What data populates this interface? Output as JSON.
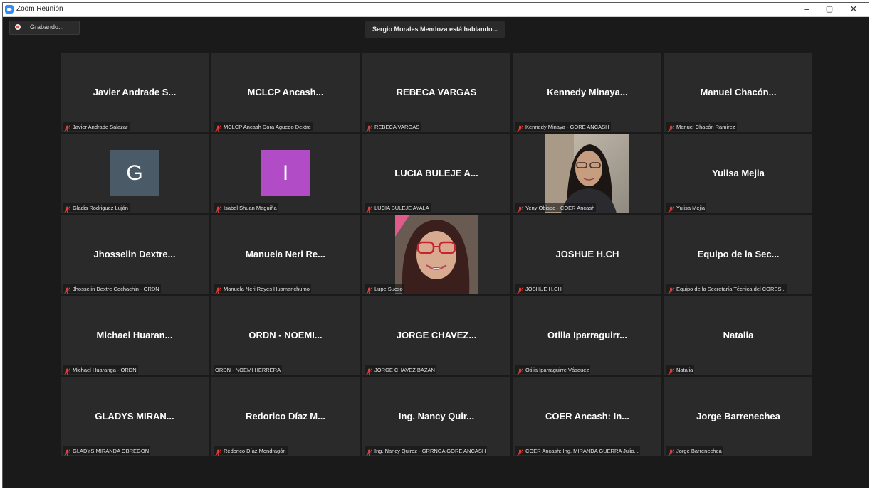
{
  "window": {
    "title": "Zoom Reunión",
    "controls": {
      "minimize": "–",
      "maximize": "▢",
      "close": "✕"
    }
  },
  "recording": {
    "label": "Grabando..."
  },
  "speaker_banner": "Sergio Morales Mendoza está hablando...",
  "participants": [
    {
      "display": "Javier Andrade S...",
      "label": "Javier Andrade Salazar",
      "muted": true
    },
    {
      "display": "MCLCP Ancash...",
      "label": "MCLCP Ancash Dora Aguedo Dextre",
      "muted": true
    },
    {
      "display": "REBECA VARGAS",
      "label": "REBECA VARGAS",
      "muted": true
    },
    {
      "display": "Kennedy Minaya...",
      "label": "Kennedy Minaya - GORE ANCASH",
      "muted": true
    },
    {
      "display": "Manuel Chacón...",
      "label": "Manuel Chacón Ramirez",
      "muted": true
    },
    {
      "avatar_letter": "G",
      "avatar_color": "#4a5a66",
      "label": "Gladis Rodriguez Luján",
      "muted": true
    },
    {
      "avatar_letter": "I",
      "avatar_color": "#b14bc6",
      "label": "Isabel Shuan Maguiña",
      "muted": true
    },
    {
      "display": "LUCIA BULEJE A...",
      "label": "LUCIA BULEJE AYALA",
      "muted": true
    },
    {
      "video": true,
      "label": "Yeny Obispo - COER Ancash",
      "muted": true
    },
    {
      "display": "Yulisa Mejia",
      "label": "Yulisa Mejia",
      "muted": true
    },
    {
      "display": "Jhosselin Dextre...",
      "label": "Jhosselin Dextre Cochachin - ORDN",
      "muted": true
    },
    {
      "display": "Manuela Neri Re...",
      "label": "Manuela Neri Reyes Huamanchumo",
      "muted": true
    },
    {
      "video": true,
      "label": "Lupe Sucso",
      "muted": true
    },
    {
      "display": "JOSHUE H.CH",
      "label": "JOSHUE H.CH",
      "muted": true
    },
    {
      "display": "Equipo de la Sec...",
      "label": "Equipo de la Secretaría Técnica del CORES...",
      "muted": true
    },
    {
      "display": "Michael Huaran...",
      "label": "Michael Huaranga - ORDN",
      "muted": true
    },
    {
      "display": "ORDN - NOEMI...",
      "label": "ORDN - NOEMI HERRERA",
      "muted": false
    },
    {
      "display": "JORGE CHAVEZ...",
      "label": "JORGE CHAVEZ BAZAN",
      "muted": true
    },
    {
      "display": "Otilia Iparraguirr...",
      "label": "Otilia Iparraguirre Vásquez",
      "muted": true
    },
    {
      "display": "Natalia",
      "label": "Natalia",
      "muted": true
    },
    {
      "display": "GLADYS MIRAN...",
      "label": "GLADYS MIRANDA OBREGON",
      "muted": true
    },
    {
      "display": "Redorico Díaz M...",
      "label": "Redorico Díaz Mondragón",
      "muted": true
    },
    {
      "display": "Ing. Nancy Quir...",
      "label": "Ing. Nancy Quiroz - GRRNGA GORE ANCASH",
      "muted": true
    },
    {
      "display": "COER Ancash: In...",
      "label": "COER Ancash: Ing. MIRANDA GUERRA Julio...",
      "muted": true
    },
    {
      "display": "Jorge Barrenechea",
      "label": "Jorge Barrenechea",
      "muted": true
    }
  ],
  "colors": {
    "background": "#1a1a1a",
    "tile": "#2a2a2a",
    "muted_mic": "#e0413a"
  }
}
